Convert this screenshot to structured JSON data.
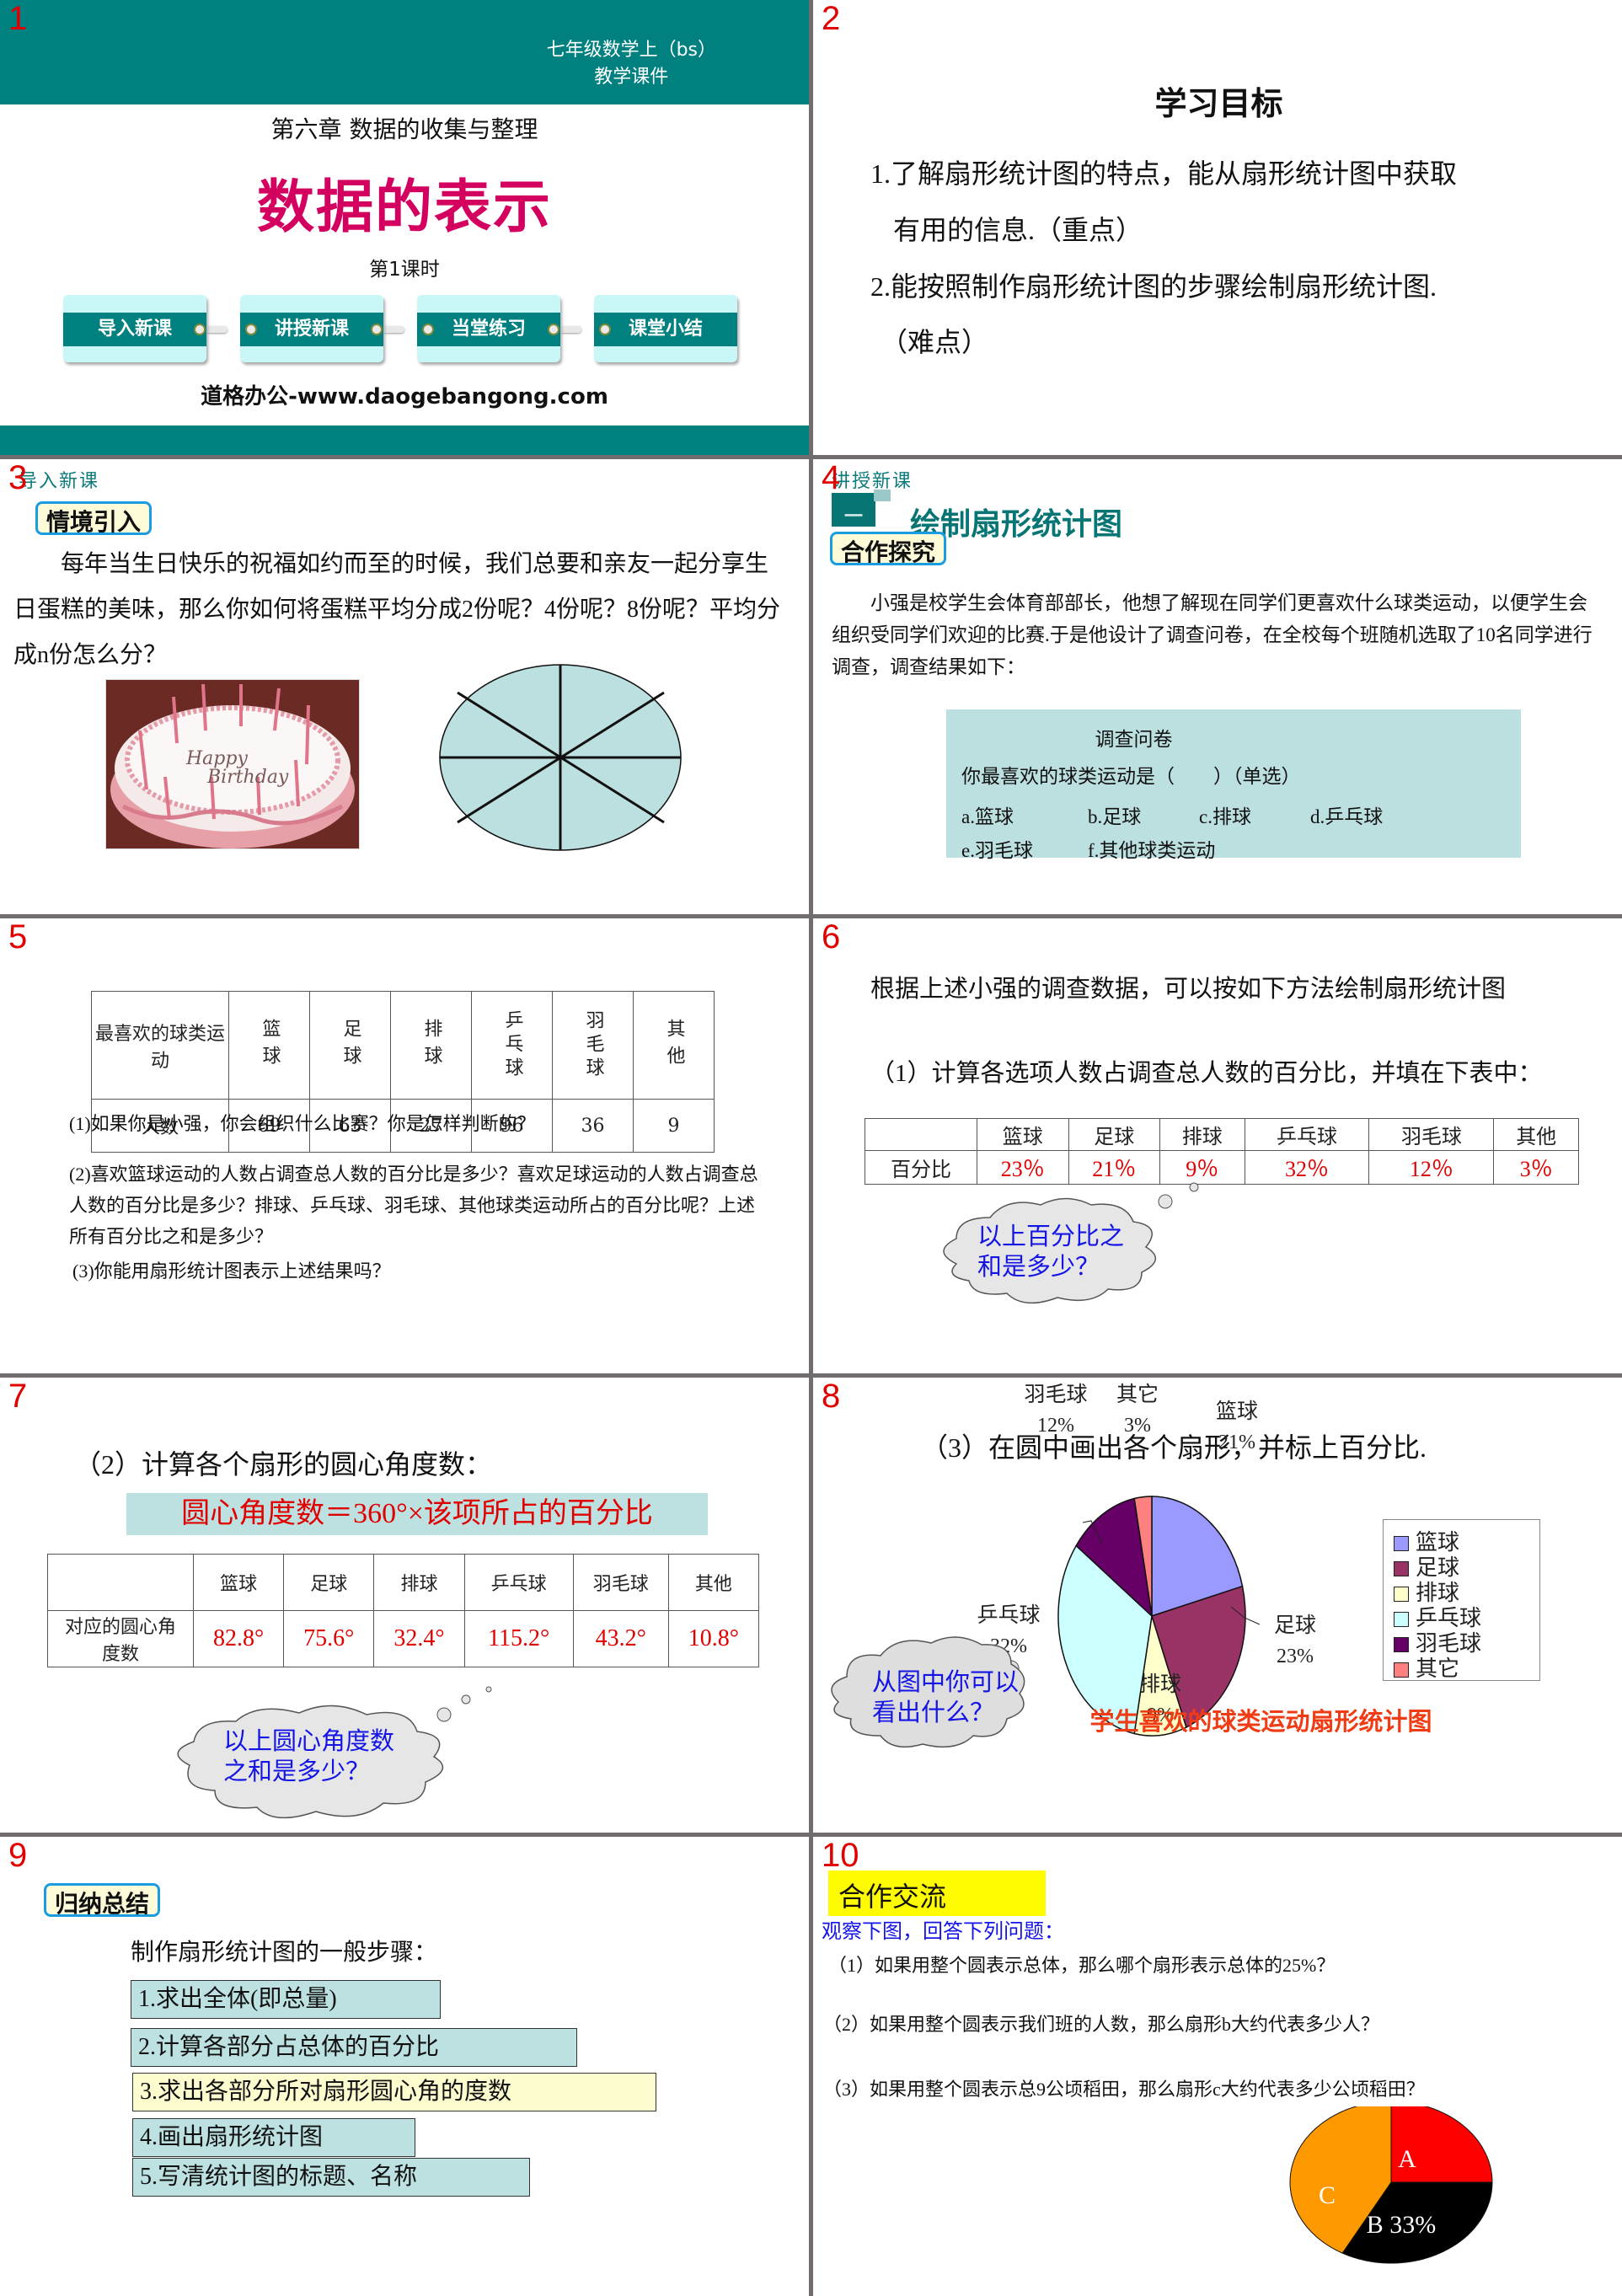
{
  "slides": [
    {
      "number": "1",
      "grade_line1": "七年级数学上（bs）",
      "grade_line2": "教学课件",
      "chapter": "第六章 数据的收集与整理",
      "title": "数据的表示",
      "lesson": "第1课时",
      "nav": [
        "导入新课",
        "讲授新课",
        "当堂练习",
        "课堂小结"
      ],
      "site": "道格办公-www.daogebangong.com"
    },
    {
      "number": "2",
      "heading": "学习目标",
      "goals": [
        "1.了解扇形统计图的特点，能从扇形统计图中获取",
        "有用的信息.（重点）",
        "2.能按照制作扇形统计图的步骤绘制扇形统计图.",
        "（难点）"
      ]
    },
    {
      "number": "3",
      "crumb": "导入新课",
      "tag": "情境引入",
      "paragraph": "每年当生日快乐的祝福如约而至的时候，我们总要和亲友一起分享生日蛋糕的美味，那么你如何将蛋糕平均分成2份呢？4份呢？8份呢？平均分成n份怎么分？",
      "cake_text1": "Happy",
      "cake_text2": "Birthday",
      "circle_parts": 8
    },
    {
      "number": "4",
      "crumb": "讲授新课",
      "section_num": "一",
      "heading": "绘制扇形统计图",
      "tag": "合作探究",
      "paragraph": "小强是校学生会体育部部长，他想了解现在同学们更喜欢什么球类运动，以便学生会组织受同学们欢迎的比赛.于是他设计了调查问卷，在全校每个班随机选取了10名同学进行调查，调查结果如下：",
      "survey_title": "调查问卷",
      "survey_question": "你最喜欢的球类运动是（　　）（单选）",
      "options": [
        "a.篮球",
        "b.足球",
        "c.排球",
        "d.乒乓球",
        "e.羽毛球",
        "f.其他球类运动"
      ]
    },
    {
      "number": "5",
      "table_header": [
        "最喜欢的球类运动",
        "篮球",
        "足球",
        "排球",
        "乒乓球",
        "羽毛球",
        "其他"
      ],
      "row_label": "人数",
      "counts": [
        "69",
        "63",
        "27",
        "96",
        "36",
        "9"
      ],
      "q1": "(1)如果你是小强，你会组织什么比赛？你是怎样判断的？",
      "q2": "(2)喜欢篮球运动的人数占调查总人数的百分比是多少？喜欢足球运动的人数占调查总人数的百分比是多少？排球、乒乓球、羽毛球、其他球类运动所占的百分比呢？上述所有百分比之和是多少？",
      "q3": "(3)你能用扇形统计图表示上述结果吗？"
    },
    {
      "number": "6",
      "line1": "根据上述小强的调查数据，可以按如下方法绘制扇形统计图",
      "line2": "（1）计算各选项人数占调查总人数的百分比，并填在下表中：",
      "table_header": [
        "",
        "篮球",
        "足球",
        "排球",
        "乒乓球",
        "羽毛球",
        "其他"
      ],
      "row_label": "百分比",
      "percents": [
        "23％",
        "21％",
        "9％",
        "32％",
        "12％",
        "3％"
      ],
      "cloud_line1": "以上百分比之",
      "cloud_line2": "和是多少？"
    },
    {
      "number": "7",
      "line1": "（2）计算各个扇形的圆心角度数：",
      "formula": "圆心角度数＝360°×该项所占的百分比",
      "table_header": [
        "",
        "篮球",
        "足球",
        "排球",
        "乒乓球",
        "羽毛球",
        "其他"
      ],
      "row_label": "对应的圆心角度数",
      "angles": [
        "82.8°",
        "75.6°",
        "32.4°",
        "115.2°",
        "43.2°",
        "10.8°"
      ],
      "cloud_line1": "以上圆心角度数",
      "cloud_line2": "之和是多少？"
    },
    {
      "number": "8",
      "line1": "（3）在圆中画出各个扇形，并标上百分比.",
      "cloud_line1": "从图中你可以",
      "cloud_line2": "看出什么？"
    },
    {
      "number": "9",
      "tag": "归纳总结",
      "intro": "制作扇形统计图的一般步骤：",
      "steps": [
        "1.求出全体(即总量)",
        "2.计算各部分占总体的百分比",
        "3.求出各部分所对扇形圆心角的度数",
        "4.画出扇形统计图",
        "5.写清统计图的标题、名称"
      ]
    },
    {
      "number": "10",
      "heading": "合作交流",
      "observe": "观察下图，回答下列问题：",
      "questions": [
        "（1）如果用整个圆表示总体，那么哪个扇形表示总体的25%？",
        "（2）如果用整个圆表示我们班的人数，那么扇形b大约代表多少人？",
        "（3）如果用整个圆表示总9公顷稻田，那么扇形c大约代表多少公顷稻田？"
      ]
    }
  ],
  "chart_data": [
    {
      "type": "pie",
      "title": "学生喜欢的球类运动扇形统计图",
      "categories": [
        "篮球",
        "足球",
        "排球",
        "乒乓球",
        "羽毛球",
        "其它"
      ],
      "values": [
        21,
        23,
        9,
        32,
        12,
        3
      ],
      "labels": [
        "21%",
        "23%",
        "9%",
        "32%",
        "12%",
        "3%"
      ],
      "colors": [
        "#9999ff",
        "#993366",
        "#ffffcc",
        "#ccffff",
        "#660066",
        "#ff8080"
      ],
      "legend": "right"
    },
    {
      "type": "pie",
      "title": "",
      "categories": [
        "A",
        "B",
        "C"
      ],
      "values": [
        25,
        33,
        42
      ],
      "labels": [
        "A",
        "B 33%",
        "C"
      ],
      "colors": [
        "#ff0000",
        "#000000",
        "#ff9900"
      ],
      "legend": "none"
    }
  ]
}
